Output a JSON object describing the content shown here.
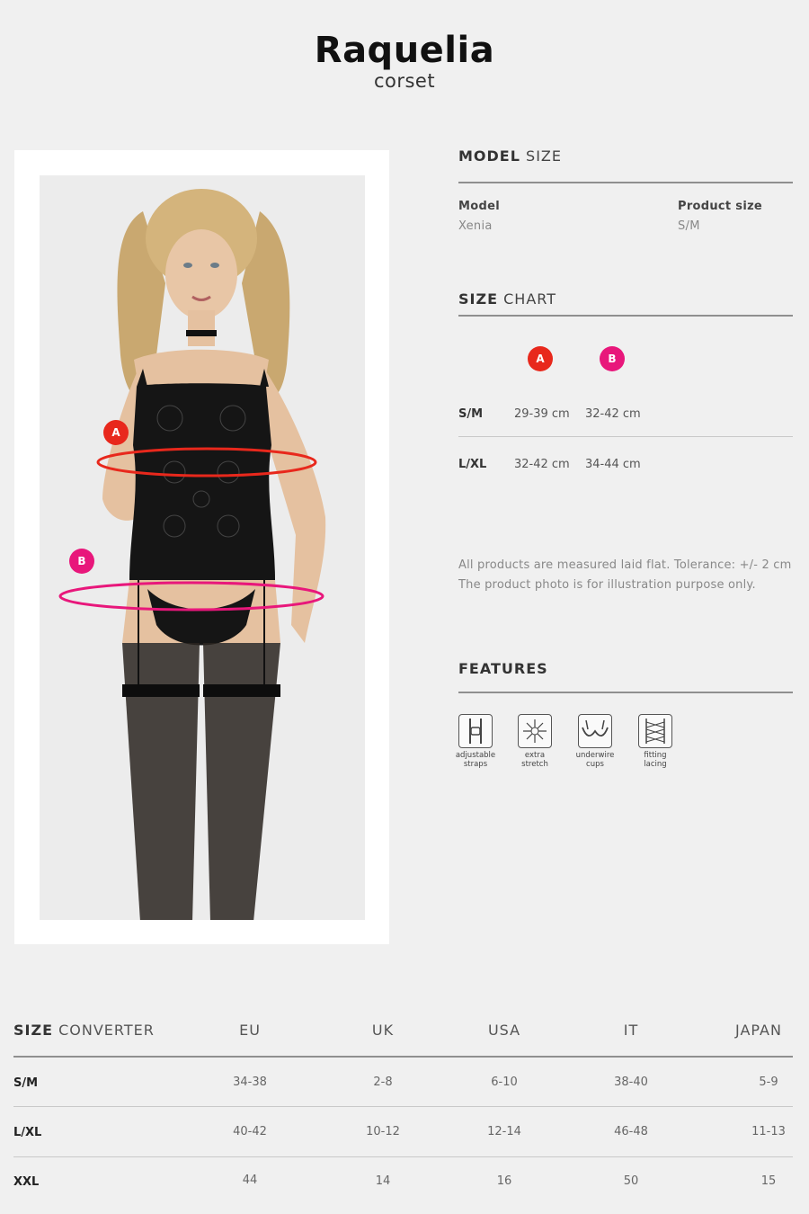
{
  "header": {
    "title": "Raquelia",
    "subtitle": "corset"
  },
  "model_size": {
    "heading_bold": "MODEL",
    "heading_rest": "SIZE",
    "model_label": "Model",
    "model_value": "Xenia",
    "product_size_label": "Product size",
    "product_size_value": "S/M"
  },
  "size_chart": {
    "heading_bold": "SIZE",
    "heading_rest": "CHART",
    "markers": [
      {
        "letter": "A",
        "color": "#e8281c"
      },
      {
        "letter": "B",
        "color": "#e8177b"
      }
    ],
    "rows": [
      {
        "size": "S/M",
        "a": "29-39 cm",
        "b": "32-42 cm"
      },
      {
        "size": "L/XL",
        "a": "32-42 cm",
        "b": "34-44 cm"
      }
    ],
    "note_line1": "All products are measured laid flat. Tolerance: +/- 2 cm",
    "note_line2": "The product photo is for illustration purpose only."
  },
  "features": {
    "heading": "FEATURES",
    "items": [
      {
        "icon": "adjustable-straps-icon",
        "line1": "adjustable",
        "line2": "straps"
      },
      {
        "icon": "extra-stretch-icon",
        "line1": "extra",
        "line2": "stretch"
      },
      {
        "icon": "underwire-cups-icon",
        "line1": "underwire",
        "line2": "cups"
      },
      {
        "icon": "fitting-lacing-icon",
        "line1": "fitting",
        "line2": "lacing"
      }
    ]
  },
  "photo": {
    "marker_a": "A",
    "marker_b": "B",
    "color_a": "#e8281c",
    "color_b": "#e8177b"
  },
  "size_converter": {
    "heading_bold": "SIZE",
    "heading_rest": "CONVERTER",
    "columns": [
      "EU",
      "UK",
      "USA",
      "IT",
      "JAPAN"
    ],
    "rows": [
      {
        "size": "S/M",
        "values": [
          "34-38",
          "2-8",
          "6-10",
          "38-40",
          "5-9"
        ]
      },
      {
        "size": "L/XL",
        "values": [
          "40-42",
          "10-12",
          "12-14",
          "46-48",
          "11-13"
        ]
      },
      {
        "size": "XXL",
        "values": [
          "44",
          "14",
          "16",
          "50",
          "15"
        ]
      }
    ]
  }
}
